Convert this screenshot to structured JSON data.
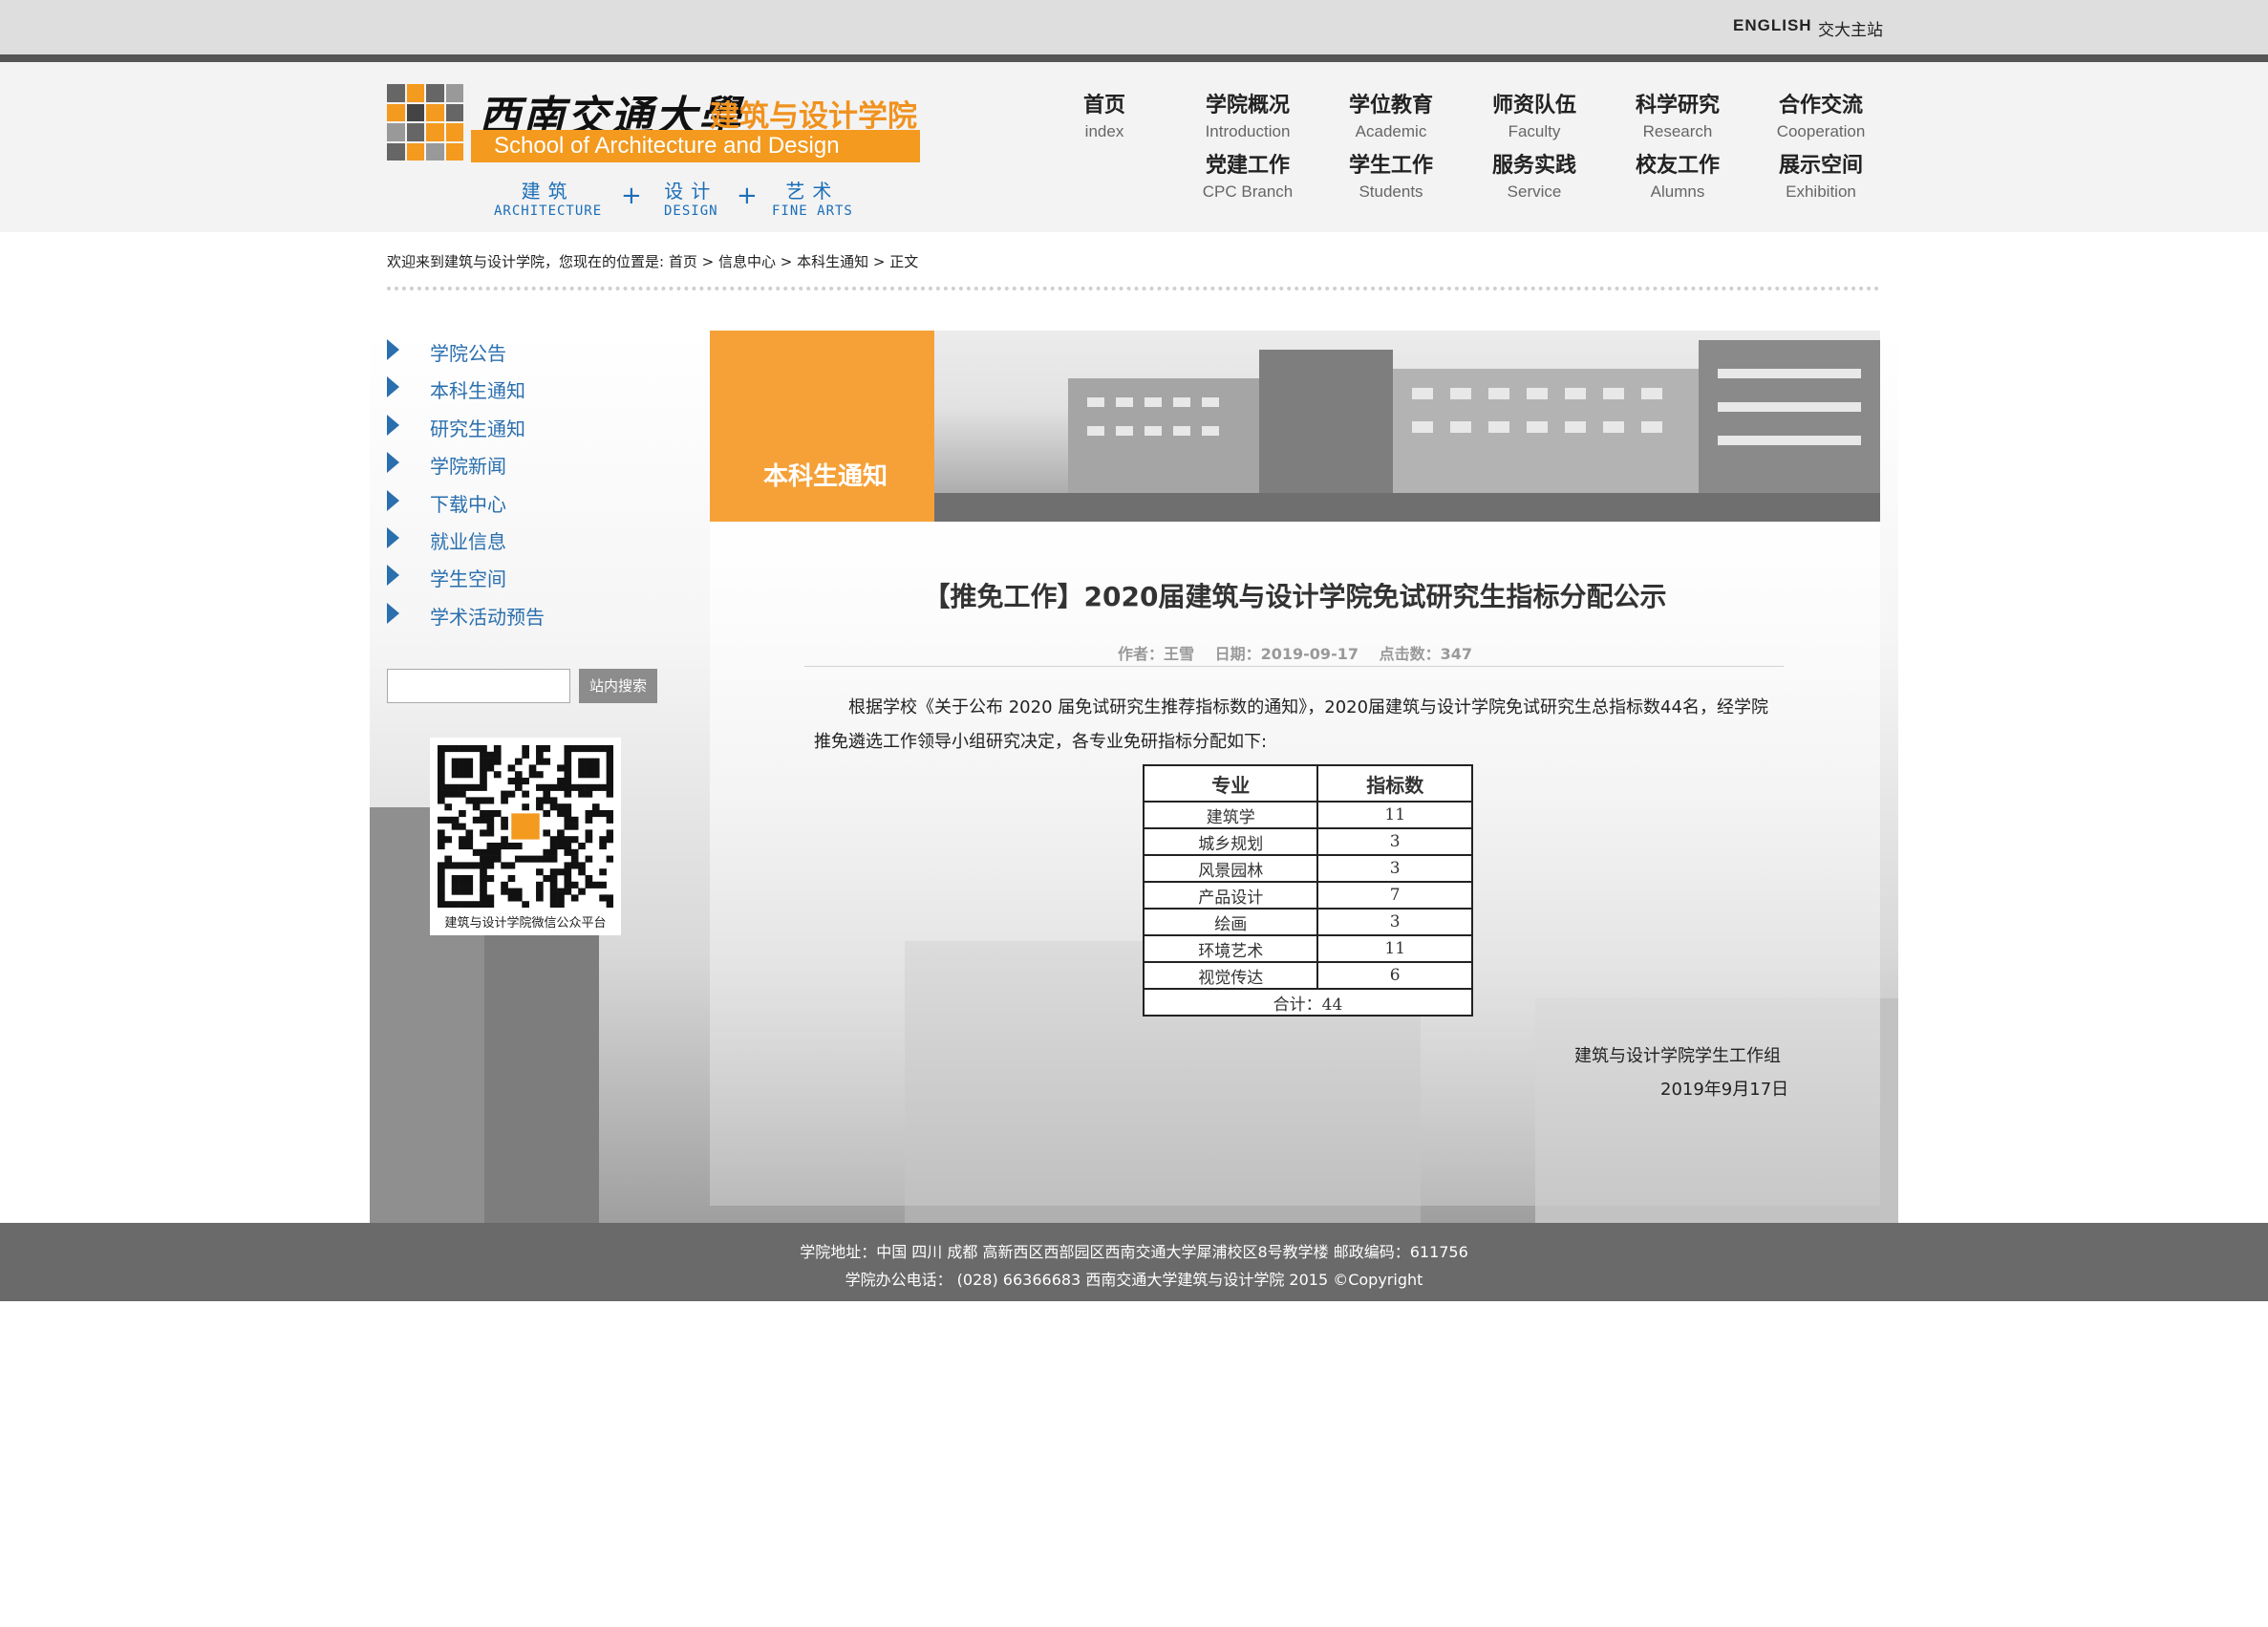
{
  "top_bar": {
    "english": "ENGLISH",
    "main_site": "交大主站"
  },
  "logo": {
    "university": "西南交通大學",
    "school_cn": "建筑与设计学院",
    "school_en": "School of Architecture and Design",
    "tagline": [
      {
        "cn": "建筑",
        "en": "ARCHITECTURE"
      },
      {
        "cn": "设计",
        "en": "DESIGN"
      },
      {
        "cn": "艺术",
        "en": "FINE ARTS"
      }
    ],
    "plus": "+",
    "grid_colors": [
      "#666666",
      "#f39a1f",
      "#999999",
      "#444444"
    ]
  },
  "nav": [
    {
      "cn": "首页",
      "en": "index"
    },
    {
      "cn": "学院概况",
      "en": "Introduction"
    },
    {
      "cn": "学位教育",
      "en": "Academic"
    },
    {
      "cn": "师资队伍",
      "en": "Faculty"
    },
    {
      "cn": "科学研究",
      "en": "Research"
    },
    {
      "cn": "合作交流",
      "en": "Cooperation"
    },
    {
      "cn": "党建工作",
      "en": "CPC Branch"
    },
    {
      "cn": "学生工作",
      "en": "Students"
    },
    {
      "cn": "服务实践",
      "en": "Service"
    },
    {
      "cn": "校友工作",
      "en": "Alumns"
    },
    {
      "cn": "展示空间",
      "en": "Exhibition"
    }
  ],
  "breadcrumb": {
    "prefix": "欢迎来到建筑与设计学院，您现在的位置是: ",
    "items": [
      "首页",
      "信息中心",
      "本科生通知",
      "正文"
    ],
    "separator": " > "
  },
  "sidebar": {
    "items": [
      "学院公告",
      "本科生通知",
      "研究生通知",
      "学院新闻",
      "下载中心",
      "就业信息",
      "学生空间",
      "学术活动预告"
    ],
    "search_button": "站内搜索",
    "search_value": "",
    "qr_caption": "建筑与设计学院微信公众平台"
  },
  "banner": {
    "title": "本科生通知"
  },
  "article": {
    "title": "【推免工作】2020届建筑与设计学院免试研究生指标分配公示",
    "meta": {
      "author": "作者：王雪",
      "date": "日期：2019-09-17",
      "clicks": "点击数：347"
    },
    "paragraph": "根据学校《关于公布 2020 届免试研究生推荐指标数的通知》，2020届建筑与设计学院免试研究生总指标数44名，经学院推免遴选工作领导小组研究决定，各专业免研指标分配如下:",
    "table": {
      "headers": [
        "专业",
        "指标数"
      ],
      "rows": [
        [
          "建筑学",
          "11"
        ],
        [
          "城乡规划",
          "3"
        ],
        [
          "风景园林",
          "3"
        ],
        [
          "产品设计",
          "7"
        ],
        [
          "绘画",
          "3"
        ],
        [
          "环境艺术",
          "11"
        ],
        [
          "视觉传达",
          "6"
        ]
      ],
      "total": "合计：44"
    },
    "signature": "建筑与设计学院学生工作组",
    "sign_date": "2019年9月17日"
  },
  "footer": {
    "line1": "学院地址：中国 四川 成都 高新西区西部园区西南交通大学犀浦校区8号教学楼 邮政编码：611756",
    "line2": "学院办公电话： (028) 66366683 西南交通大学建筑与设计学院 2015 ©Copyright"
  },
  "colors": {
    "accent": "#f39a1f",
    "link": "#2a6fae",
    "footer": "#6a6a6a"
  }
}
